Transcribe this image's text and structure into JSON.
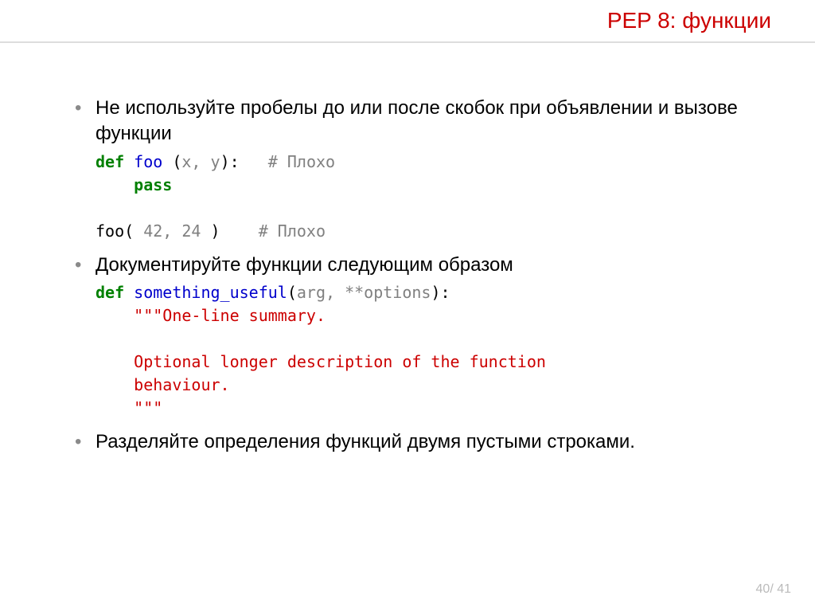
{
  "title": "PEP 8: функции",
  "bullets": [
    {
      "text": "Не используйте пробелы до или после скобок при объявлении и вызове функции",
      "code_html": "<span class='kw'>def</span> <span class='fn'>foo</span><span class='plain'> (</span><span class='args'>x, y</span><span class='plain'>):   </span><span class='cmt'># Плохо</span>\n    <span class='kw'>pass</span>\n\n<span class='plain'>foo(</span><span class='args'> 42, 24 </span><span class='plain'>)    </span><span class='cmt'># Плохо</span>"
    },
    {
      "text": "Документируйте функции следующим образом",
      "code_html": "<span class='kw'>def</span> <span class='fn'>something_useful</span><span class='plain'>(</span><span class='args'>arg, **options</span><span class='plain'>):</span>\n    <span class='str'>\"\"\"One-line summary.\n\n    Optional longer description of the function\n    behaviour.\n    \"\"\"</span>"
    },
    {
      "text": "Разделяйте определения функций двумя пустыми строками.",
      "code_html": ""
    }
  ],
  "page": "40/ 41"
}
